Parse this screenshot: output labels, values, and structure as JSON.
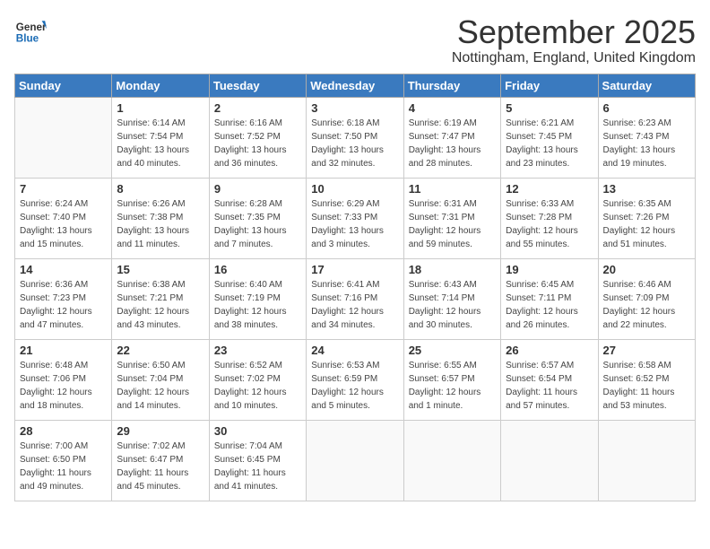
{
  "header": {
    "logo_general": "General",
    "logo_blue": "Blue",
    "month": "September 2025",
    "location": "Nottingham, England, United Kingdom"
  },
  "days_of_week": [
    "Sunday",
    "Monday",
    "Tuesday",
    "Wednesday",
    "Thursday",
    "Friday",
    "Saturday"
  ],
  "weeks": [
    [
      {
        "day": "",
        "info": ""
      },
      {
        "day": "1",
        "info": "Sunrise: 6:14 AM\nSunset: 7:54 PM\nDaylight: 13 hours\nand 40 minutes."
      },
      {
        "day": "2",
        "info": "Sunrise: 6:16 AM\nSunset: 7:52 PM\nDaylight: 13 hours\nand 36 minutes."
      },
      {
        "day": "3",
        "info": "Sunrise: 6:18 AM\nSunset: 7:50 PM\nDaylight: 13 hours\nand 32 minutes."
      },
      {
        "day": "4",
        "info": "Sunrise: 6:19 AM\nSunset: 7:47 PM\nDaylight: 13 hours\nand 28 minutes."
      },
      {
        "day": "5",
        "info": "Sunrise: 6:21 AM\nSunset: 7:45 PM\nDaylight: 13 hours\nand 23 minutes."
      },
      {
        "day": "6",
        "info": "Sunrise: 6:23 AM\nSunset: 7:43 PM\nDaylight: 13 hours\nand 19 minutes."
      }
    ],
    [
      {
        "day": "7",
        "info": "Sunrise: 6:24 AM\nSunset: 7:40 PM\nDaylight: 13 hours\nand 15 minutes."
      },
      {
        "day": "8",
        "info": "Sunrise: 6:26 AM\nSunset: 7:38 PM\nDaylight: 13 hours\nand 11 minutes."
      },
      {
        "day": "9",
        "info": "Sunrise: 6:28 AM\nSunset: 7:35 PM\nDaylight: 13 hours\nand 7 minutes."
      },
      {
        "day": "10",
        "info": "Sunrise: 6:29 AM\nSunset: 7:33 PM\nDaylight: 13 hours\nand 3 minutes."
      },
      {
        "day": "11",
        "info": "Sunrise: 6:31 AM\nSunset: 7:31 PM\nDaylight: 12 hours\nand 59 minutes."
      },
      {
        "day": "12",
        "info": "Sunrise: 6:33 AM\nSunset: 7:28 PM\nDaylight: 12 hours\nand 55 minutes."
      },
      {
        "day": "13",
        "info": "Sunrise: 6:35 AM\nSunset: 7:26 PM\nDaylight: 12 hours\nand 51 minutes."
      }
    ],
    [
      {
        "day": "14",
        "info": "Sunrise: 6:36 AM\nSunset: 7:23 PM\nDaylight: 12 hours\nand 47 minutes."
      },
      {
        "day": "15",
        "info": "Sunrise: 6:38 AM\nSunset: 7:21 PM\nDaylight: 12 hours\nand 43 minutes."
      },
      {
        "day": "16",
        "info": "Sunrise: 6:40 AM\nSunset: 7:19 PM\nDaylight: 12 hours\nand 38 minutes."
      },
      {
        "day": "17",
        "info": "Sunrise: 6:41 AM\nSunset: 7:16 PM\nDaylight: 12 hours\nand 34 minutes."
      },
      {
        "day": "18",
        "info": "Sunrise: 6:43 AM\nSunset: 7:14 PM\nDaylight: 12 hours\nand 30 minutes."
      },
      {
        "day": "19",
        "info": "Sunrise: 6:45 AM\nSunset: 7:11 PM\nDaylight: 12 hours\nand 26 minutes."
      },
      {
        "day": "20",
        "info": "Sunrise: 6:46 AM\nSunset: 7:09 PM\nDaylight: 12 hours\nand 22 minutes."
      }
    ],
    [
      {
        "day": "21",
        "info": "Sunrise: 6:48 AM\nSunset: 7:06 PM\nDaylight: 12 hours\nand 18 minutes."
      },
      {
        "day": "22",
        "info": "Sunrise: 6:50 AM\nSunset: 7:04 PM\nDaylight: 12 hours\nand 14 minutes."
      },
      {
        "day": "23",
        "info": "Sunrise: 6:52 AM\nSunset: 7:02 PM\nDaylight: 12 hours\nand 10 minutes."
      },
      {
        "day": "24",
        "info": "Sunrise: 6:53 AM\nSunset: 6:59 PM\nDaylight: 12 hours\nand 5 minutes."
      },
      {
        "day": "25",
        "info": "Sunrise: 6:55 AM\nSunset: 6:57 PM\nDaylight: 12 hours\nand 1 minute."
      },
      {
        "day": "26",
        "info": "Sunrise: 6:57 AM\nSunset: 6:54 PM\nDaylight: 11 hours\nand 57 minutes."
      },
      {
        "day": "27",
        "info": "Sunrise: 6:58 AM\nSunset: 6:52 PM\nDaylight: 11 hours\nand 53 minutes."
      }
    ],
    [
      {
        "day": "28",
        "info": "Sunrise: 7:00 AM\nSunset: 6:50 PM\nDaylight: 11 hours\nand 49 minutes."
      },
      {
        "day": "29",
        "info": "Sunrise: 7:02 AM\nSunset: 6:47 PM\nDaylight: 11 hours\nand 45 minutes."
      },
      {
        "day": "30",
        "info": "Sunrise: 7:04 AM\nSunset: 6:45 PM\nDaylight: 11 hours\nand 41 minutes."
      },
      {
        "day": "",
        "info": ""
      },
      {
        "day": "",
        "info": ""
      },
      {
        "day": "",
        "info": ""
      },
      {
        "day": "",
        "info": ""
      }
    ]
  ]
}
